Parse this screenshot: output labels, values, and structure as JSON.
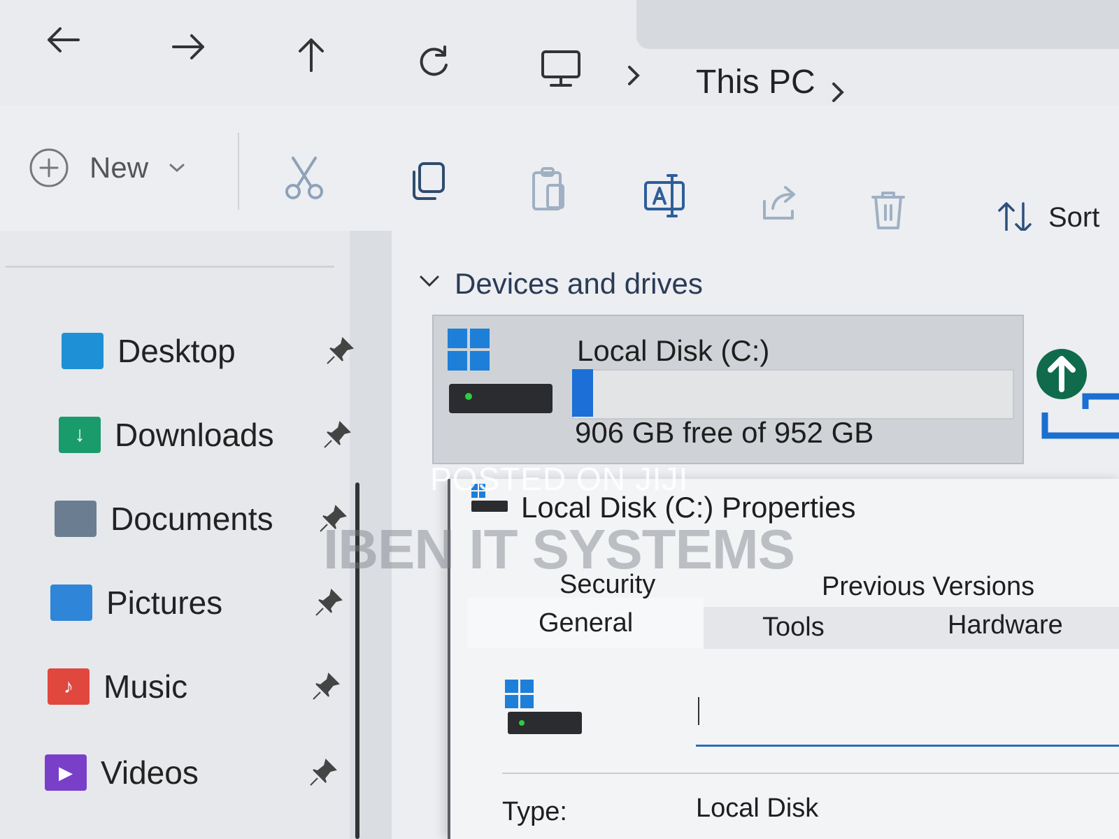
{
  "address_bar": {
    "crumbs": [
      "This PC"
    ]
  },
  "command_bar": {
    "new_label": "New",
    "sort_label": "Sort"
  },
  "sidebar": {
    "items": [
      {
        "label": "Desktop",
        "icon": "desktop-folder-icon",
        "color": "#1e90d6"
      },
      {
        "label": "Downloads",
        "icon": "downloads-folder-icon",
        "color": "#1a9b6c"
      },
      {
        "label": "Documents",
        "icon": "documents-folder-icon",
        "color": "#6b7d91"
      },
      {
        "label": "Pictures",
        "icon": "pictures-folder-icon",
        "color": "#2f86d8"
      },
      {
        "label": "Music",
        "icon": "music-folder-icon",
        "color": "#e0483f"
      },
      {
        "label": "Videos",
        "icon": "videos-folder-icon",
        "color": "#7a3fc9"
      }
    ]
  },
  "content": {
    "section_title": "Devices and drives",
    "drive": {
      "name": "Local Disk (C:)",
      "free_text": "906 GB free of 952 GB",
      "used_fraction": 0.048
    }
  },
  "properties_dialog": {
    "title": "Local Disk (C:) Properties",
    "tabs_row1": [
      "Security",
      "Previous Versions"
    ],
    "tabs_row2": [
      "General",
      "Tools",
      "Hardware"
    ],
    "name_value": "",
    "type_label": "Type:",
    "type_value": "Local Disk"
  },
  "watermarks": {
    "posted": "POSTED ON JIJI",
    "company": "IBEN IT SYSTEMS"
  },
  "colors": {
    "accent": "#1c6fd6",
    "upload_green": "#0f6b4b"
  }
}
